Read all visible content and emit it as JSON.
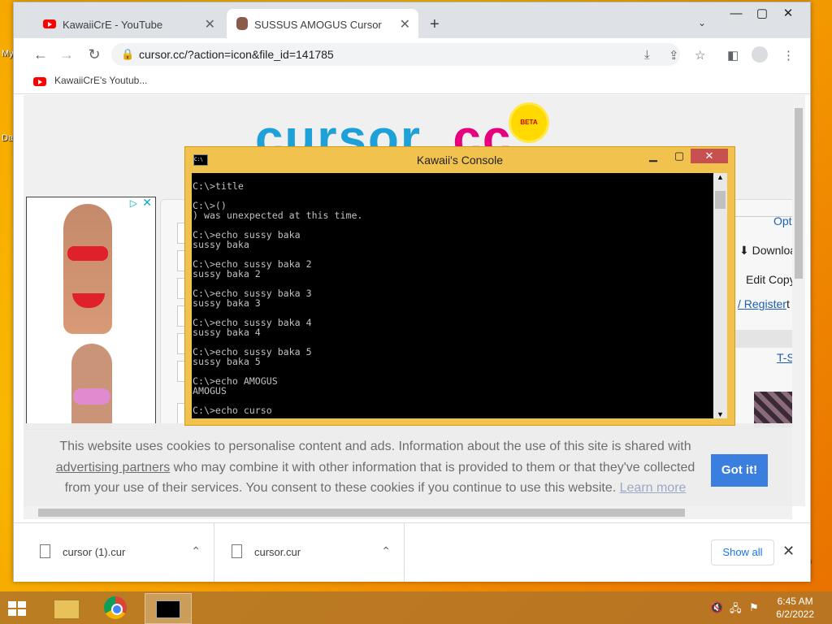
{
  "desktop": {
    "label_top": "My",
    "label_mid": "Dat"
  },
  "browser": {
    "tabs": [
      {
        "title": "KawaiiCrE - YouTube",
        "icon": "youtube-icon"
      },
      {
        "title": "SUSSUS AMOGUS Cursor",
        "icon": "site-favicon"
      }
    ],
    "new_tab": "+",
    "url": "cursor.cc/?action=icon&file_id=141785",
    "bookmark": "KawaiiCrE's Youtub..."
  },
  "page": {
    "logo_left": "cursor",
    "logo_right": "cc",
    "beta": "BETA",
    "side_links": [
      "Opt",
      "⬇ Downloa",
      "Edit Copy",
      "/ Register",
      "t",
      "T-S"
    ],
    "cookie": {
      "text_1": "This website uses cookies to personalise content and ads. Information about the use of this site is shared with",
      "link_partners": "advertising partners",
      "text_2": " who may combine it with other information that is provided to them or that they've collected from your use of their services. You consent to these cookies if you continue to use this website. ",
      "link_learn": "Learn more",
      "button": "Got it!"
    }
  },
  "console": {
    "title": "Kawaii's Console",
    "lines": "C:\\>title\n\nC:\\>()\n) was unexpected at this time.\n\nC:\\>echo sussy baka\nsussy baka\n\nC:\\>echo sussy baka 2\nsussy baka 2\n\nC:\\>echo sussy baka 3\nsussy baka 3\n\nC:\\>echo sussy baka 4\nsussy baka 4\n\nC:\\>echo sussy baka 5\nsussy baka 5\n\nC:\\>echo AMOGUS\nAMOGUS\n\nC:\\>echo curso"
  },
  "downloads": {
    "items": [
      "cursor (1).cur",
      "cursor.cur"
    ],
    "show_all": "Show all"
  },
  "taskbar": {
    "time": "6:45 AM",
    "date": "6/2/2022",
    "edge_text": "n"
  }
}
